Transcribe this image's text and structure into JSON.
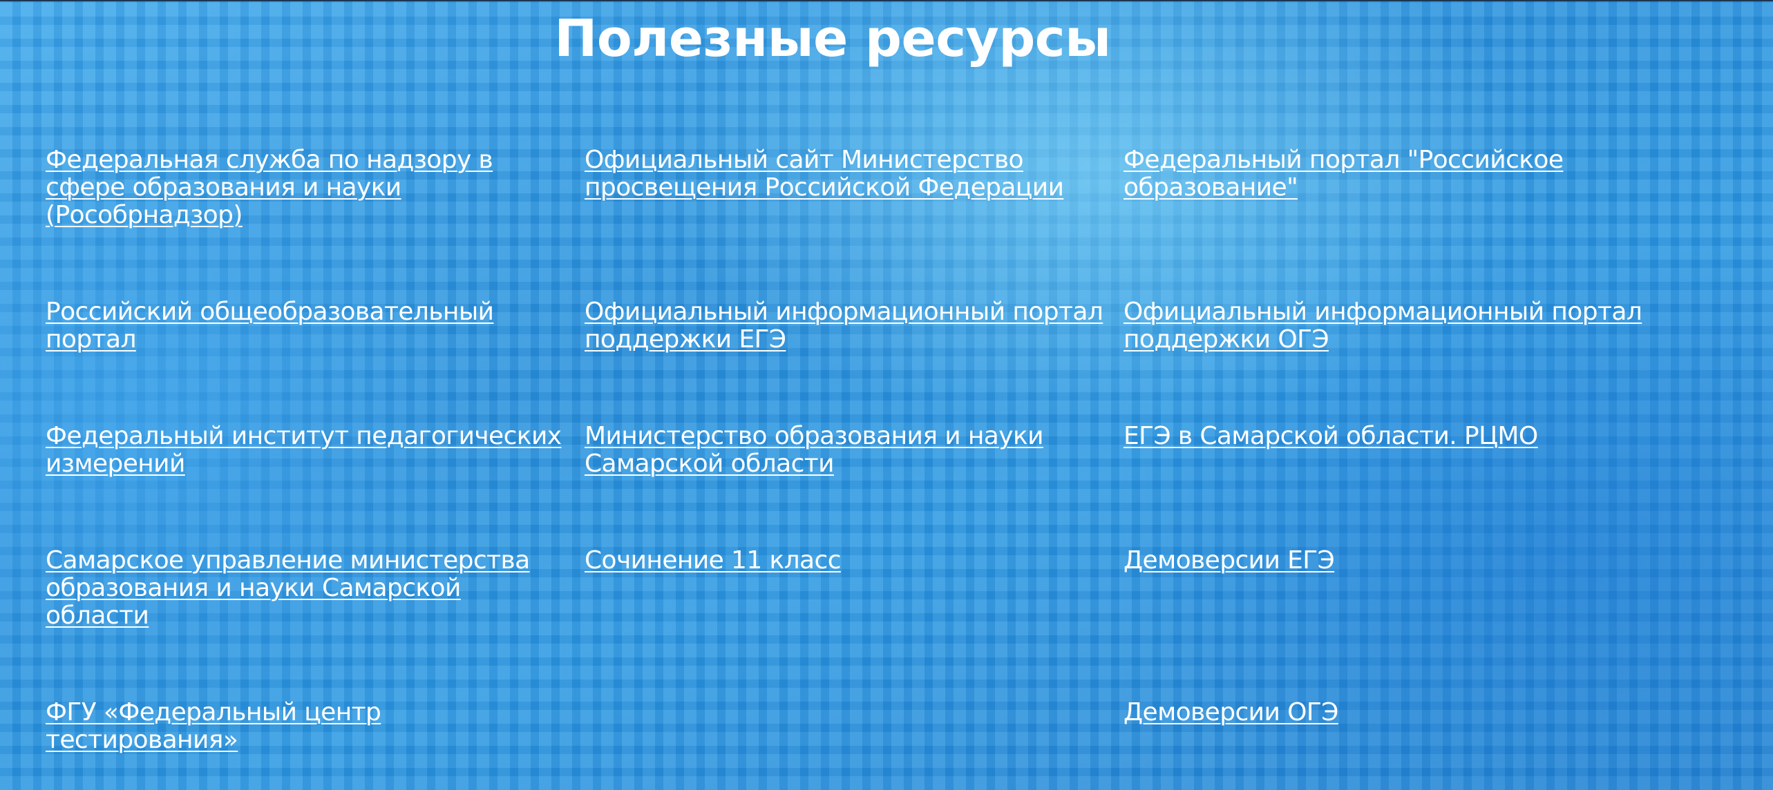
{
  "page": {
    "title": "Полезные ресурсы"
  },
  "columns": [
    {
      "links": [
        "Федеральная служба по надзору в сфере образования и науки (Рособрнадзор)",
        "Российский общеобразовательный портал",
        "Федеральный институт педагогических измерений",
        "Самарское управление министерства образования и науки Самарской области",
        "ФГУ «Федеральный центр тестирования»"
      ]
    },
    {
      "links": [
        "Официальный сайт Министерство просвещения Российской Федерации",
        "Официальный информационный портал поддержки ЕГЭ",
        "Министерство образования и науки Самарской области",
        "Сочинение 11 класс"
      ]
    },
    {
      "links": [
        "Федеральный портал \"Российское образование\"",
        "Официальный информационный портал поддержки ОГЭ",
        "ЕГЭ в Самарской области. РЦМО",
        "Демоверсии ЕГЭ",
        "Демоверсии ОГЭ"
      ]
    }
  ],
  "colors": {
    "background": "#2e9ee6",
    "text": "#ffffff"
  }
}
